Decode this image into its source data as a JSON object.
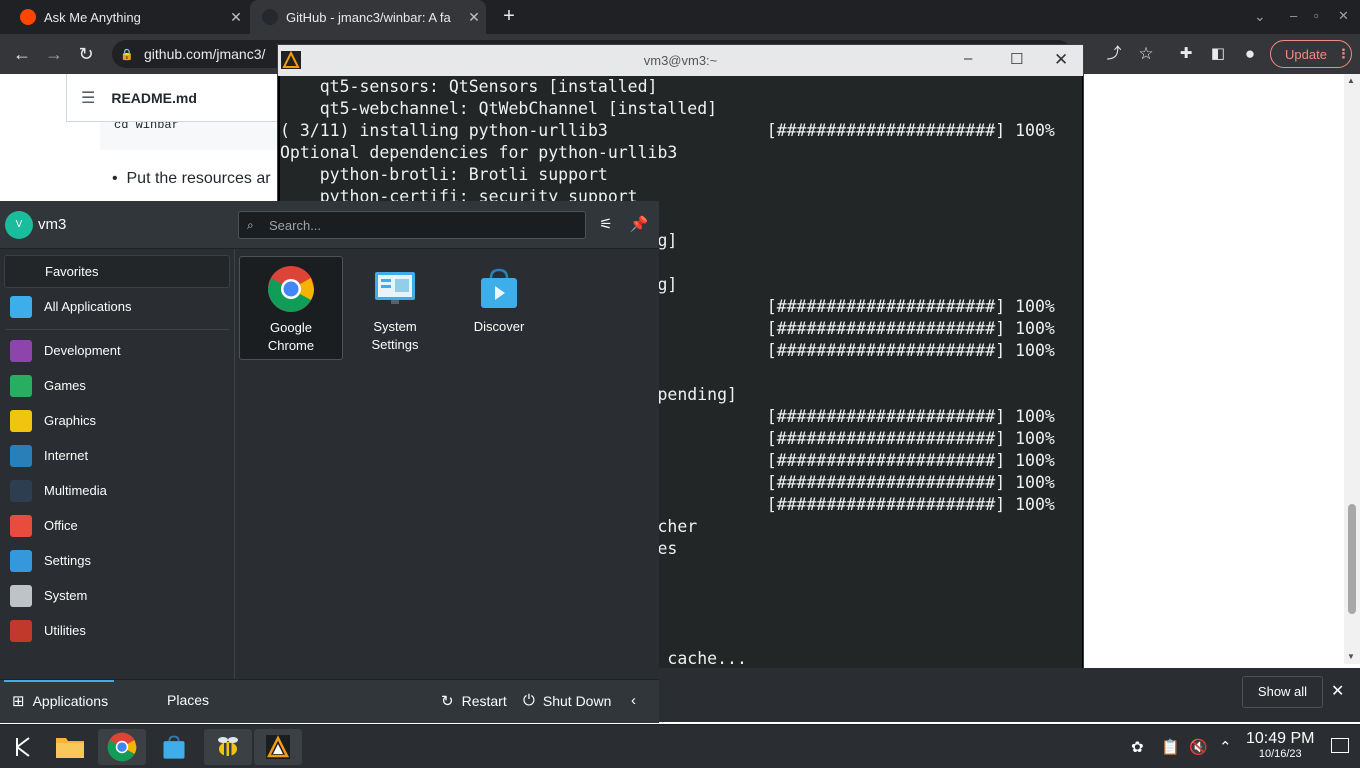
{
  "browser": {
    "tabs": [
      {
        "title": "Ask Me Anything",
        "favicon_color": "#ff4500"
      },
      {
        "title": "GitHub - jmanc3/winbar: A fa",
        "favicon_color": "#24292f"
      }
    ],
    "url": "github.com/jmanc3/",
    "update_label": "Update"
  },
  "github_page": {
    "file_name": "README.md",
    "code_text": "cd winbar",
    "bullet_text": "Put the resources ar"
  },
  "konsole": {
    "title": "vm3@vm3:~",
    "lines": [
      {
        "text": "    qt5-sensors: QtSensors [installed]",
        "row": 0
      },
      {
        "text": "    qt5-webchannel: QtWebChannel [installed]",
        "row": 1
      },
      {
        "text": "( 3/11) installing python-urllib3                [######################] 100%",
        "row": 2
      },
      {
        "text": "Optional dependencies for python-urllib3",
        "row": 3
      },
      {
        "text": "    python-brotli: Brotli support",
        "row": 4
      },
      {
        "text": "    python-certifi: security support",
        "row": 5
      },
      {
        "text": "                                   ort",
        "row": 6
      },
      {
        "text": "                                   ding]",
        "row": 7
      },
      {
        "text": "                                   ding]",
        "row": 9
      },
      {
        "text": "                                                 [######################] 100%",
        "row": 10
      },
      {
        "text": "                                                 [######################] 100%",
        "row": 11
      },
      {
        "text": "                                                 [######################] 100%",
        "row": 12
      },
      {
        "text": "                                   sts",
        "row": 13
      },
      {
        "text": "                                   t [pending]",
        "row": 14
      },
      {
        "text": "                                                 [######################] 100%",
        "row": 15
      },
      {
        "text": "                                                 [######################] 100%",
        "row": 16
      },
      {
        "text": "                                                 [######################] 100%",
        "row": 17
      },
      {
        "text": "                                                 [######################] 100%",
        "row": 18
      },
      {
        "text": "                                                 [######################] 100%",
        "row": 19
      },
      {
        "text": "                                   auncher",
        "row": 20
      },
      {
        "text": "                                   files",
        "row": 21
      },
      {
        "text": "                                   ype cache...",
        "row": 26
      }
    ]
  },
  "launcher": {
    "username": "vm3",
    "avatar_letter": "V",
    "search_placeholder": "Search...",
    "sidebar": [
      {
        "label": "Favorites",
        "icon": "favorites-icon",
        "color": "#2a2e32"
      },
      {
        "label": "All Applications",
        "icon": "all-applications-icon",
        "color": "#3daee9"
      },
      {
        "label": "Development",
        "icon": "development-icon",
        "color": "#8e44ad"
      },
      {
        "label": "Games",
        "icon": "games-icon",
        "color": "#27ae60"
      },
      {
        "label": "Graphics",
        "icon": "graphics-icon",
        "color": "#f1c40f"
      },
      {
        "label": "Internet",
        "icon": "internet-icon",
        "color": "#2980b9"
      },
      {
        "label": "Multimedia",
        "icon": "multimedia-icon",
        "color": "#2c3e50"
      },
      {
        "label": "Office",
        "icon": "office-icon",
        "color": "#e74c3c"
      },
      {
        "label": "Settings",
        "icon": "settings-icon",
        "color": "#3498db"
      },
      {
        "label": "System",
        "icon": "system-icon",
        "color": "#bdc3c7"
      },
      {
        "label": "Utilities",
        "icon": "utilities-icon",
        "color": "#c0392b"
      }
    ],
    "favorites": [
      {
        "line1": "Google",
        "line2": "Chrome",
        "icon": "google-chrome-icon"
      },
      {
        "line1": "System",
        "line2": "Settings",
        "icon": "system-settings-icon"
      },
      {
        "line1": "Discover",
        "line2": "",
        "icon": "discover-icon"
      }
    ],
    "footer": {
      "applications": "Applications",
      "places": "Places",
      "restart": "Restart",
      "shutdown": "Shut Down"
    }
  },
  "notification": {
    "show_all": "Show all"
  },
  "taskbar": {
    "time": "10:49 PM",
    "date": "10/16/23"
  }
}
